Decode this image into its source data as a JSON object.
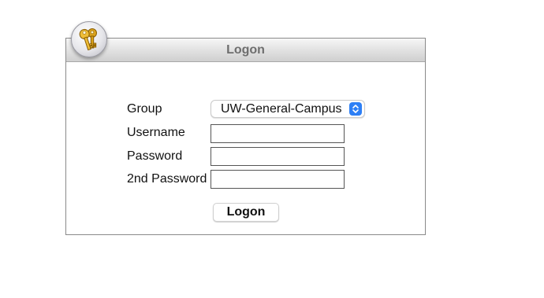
{
  "dialog": {
    "title": "Logon",
    "icon": "keys-icon"
  },
  "form": {
    "group_label": "Group",
    "group_value": "UW-General-Campus",
    "username_label": "Username",
    "username_value": "",
    "password_label": "Password",
    "password_value": "",
    "second_password_label": "2nd Password",
    "second_password_value": "",
    "submit_label": "Logon"
  },
  "colors": {
    "select_accent": "#2d7ff5",
    "title_text": "#6e6e6e"
  }
}
